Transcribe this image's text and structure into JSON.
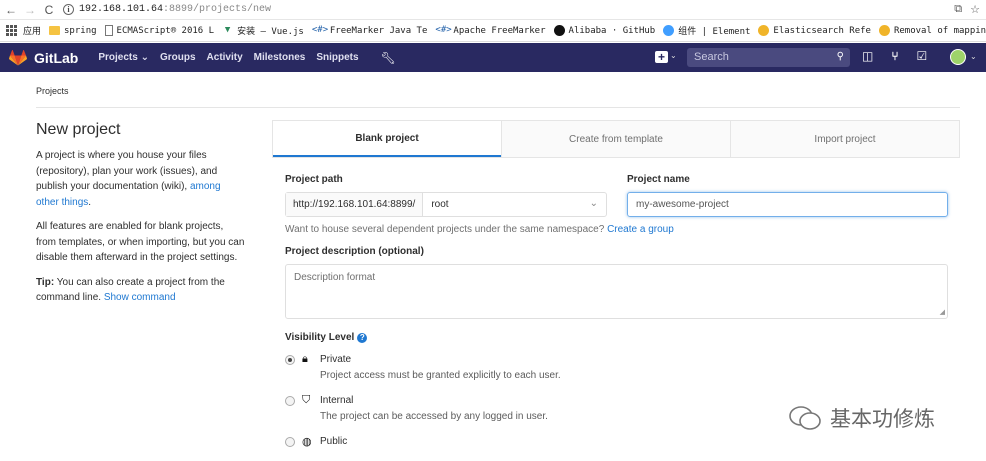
{
  "browser": {
    "url_host": "192.168.101.64",
    "url_path": ":8899/projects/new",
    "bookmarks": [
      {
        "label": "应用",
        "icon": "apps-grid-icon"
      },
      {
        "label": "spring",
        "icon": "folder-icon"
      },
      {
        "label": "ECMAScript® 2016 L",
        "icon": "page-icon"
      },
      {
        "label": "安装 — Vue.js",
        "icon": "vue-icon"
      },
      {
        "label": "FreeMarker Java Te",
        "icon": "freemarker-icon"
      },
      {
        "label": "Apache FreeMarker",
        "icon": "freemarker-icon"
      },
      {
        "label": "Alibaba · GitHub",
        "icon": "github-icon"
      },
      {
        "label": "组件 | Element",
        "icon": "element-icon"
      },
      {
        "label": "Elasticsearch Refe",
        "icon": "elastic-icon"
      },
      {
        "label": "Removal of mapping",
        "icon": "elastic-icon"
      }
    ]
  },
  "navbar": {
    "brand": "GitLab",
    "menu": [
      "Projects ⌄",
      "Groups",
      "Activity",
      "Milestones",
      "Snippets"
    ],
    "search_placeholder": "Search"
  },
  "breadcrumb": "Projects",
  "sidebar": {
    "title": "New project",
    "p1_text": "A project is where you house your files (repository), plan your work (issues), and publish your documentation (wiki), ",
    "p1_link": "among other things",
    "p1_end": ".",
    "p2": "All features are enabled for blank projects, from templates, or when importing, but you can disable them afterward in the project settings.",
    "tip_label": "Tip:",
    "tip_text": " You can also create a project from the command line. ",
    "tip_link": "Show command"
  },
  "tabs": [
    "Blank project",
    "Create from template",
    "Import project"
  ],
  "form": {
    "path_label": "Project path",
    "path_prefix": "http://192.168.101.64:8899/",
    "namespace": "root",
    "name_label": "Project name",
    "name_value": "my-awesome-project",
    "help_text": "Want to house several dependent projects under the same namespace? ",
    "help_link": "Create a group",
    "desc_label": "Project description (optional)",
    "desc_placeholder": "Description format",
    "visibility_label": "Visibility Level",
    "visibility": [
      {
        "title": "Private",
        "desc": "Project access must be granted explicitly to each user.",
        "checked": true,
        "icon": "lock-icon"
      },
      {
        "title": "Internal",
        "desc": "The project can be accessed by any logged in user.",
        "checked": false,
        "icon": "shield-icon"
      },
      {
        "title": "Public",
        "desc": "",
        "checked": false,
        "icon": "globe-icon"
      }
    ]
  },
  "watermark": "基本功修炼",
  "colors": {
    "navbar": "#292961",
    "link": "#1f78d1",
    "search_bg": "#4a4a7f"
  }
}
